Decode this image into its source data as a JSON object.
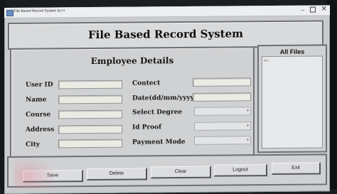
{
  "window": {
    "title_bar_text": "File Based Record System by H",
    "minimize_glyph": "–",
    "close_glyph": "✕"
  },
  "header": {
    "title": "File Based Record System"
  },
  "details": {
    "section_title": "Employee Details",
    "left_labels": [
      "User ID",
      "Name",
      "Course",
      "Address",
      "City"
    ],
    "right_labels": [
      "Contect",
      "Date(dd/mm/yyyy)",
      "Select Degree",
      "Id Proof",
      "Payment Mode"
    ],
    "combo_arrow": "▾"
  },
  "files": {
    "title": "All Files",
    "items": [
      "ALL"
    ]
  },
  "buttons": {
    "save": "Save",
    "delete": "Delete",
    "clear": "Clear",
    "logout": "Logout",
    "exit": "Exit"
  }
}
